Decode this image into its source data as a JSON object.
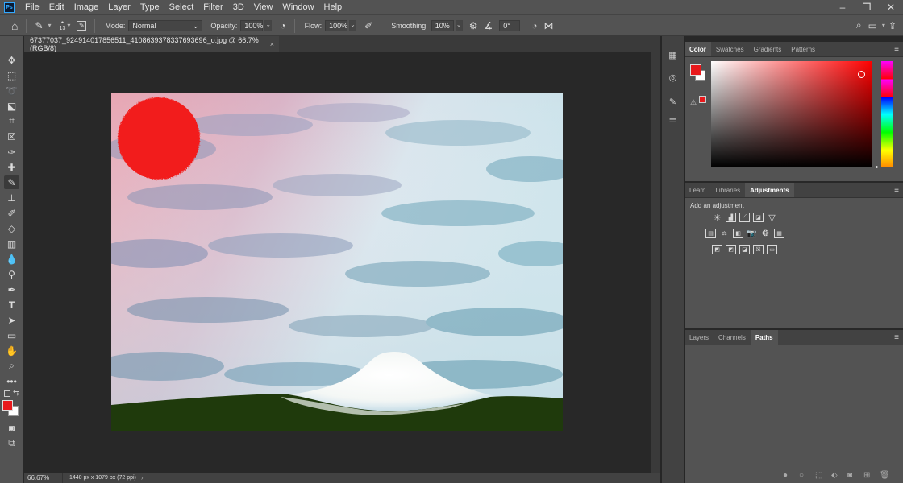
{
  "app": {
    "logo": "Ps"
  },
  "menu": [
    "File",
    "Edit",
    "Image",
    "Layer",
    "Type",
    "Select",
    "Filter",
    "3D",
    "View",
    "Window",
    "Help"
  ],
  "options": {
    "brush_size": "13",
    "mode_label": "Mode:",
    "mode_value": "Normal",
    "opacity_label": "Opacity:",
    "opacity_value": "100%",
    "flow_label": "Flow:",
    "flow_value": "100%",
    "smoothing_label": "Smoothing:",
    "smoothing_value": "10%",
    "angle_value": "0°"
  },
  "document": {
    "tab_title": "67377037_924914017856511_4108639378337693696_o.jpg @ 66.7% (RGB/8)",
    "close": "×"
  },
  "status": {
    "zoom": "66.67%",
    "info": "1440 px x 1079 px (72 ppi)",
    "chevron": "›"
  },
  "color_panel": {
    "tabs": [
      "Color",
      "Swatches",
      "Gradients",
      "Patterns"
    ],
    "active": "Color",
    "fg": "#e8191c",
    "bg": "#ffffff"
  },
  "adjust_panel": {
    "tabs": [
      "Learn",
      "Libraries",
      "Adjustments"
    ],
    "active": "Adjustments",
    "heading": "Add an adjustment"
  },
  "layers_panel": {
    "tabs": [
      "Layers",
      "Channels",
      "Paths"
    ],
    "active": "Paths"
  },
  "tools": [
    "move-icon",
    "marquee-icon",
    "lasso-icon",
    "quick-select-icon",
    "crop-icon",
    "frame-icon",
    "eyedropper-icon",
    "healing-icon",
    "brush-icon",
    "stamp-icon",
    "history-brush-icon",
    "eraser-icon",
    "gradient-icon",
    "blur-icon",
    "dodge-icon",
    "pen-icon",
    "type-icon",
    "path-select-icon",
    "shape-icon",
    "hand-icon",
    "zoom-icon",
    "more-icon"
  ],
  "colors": {
    "sun": "#f21e1a",
    "ground": "#1f3a0c",
    "snow": "#ffffff"
  }
}
